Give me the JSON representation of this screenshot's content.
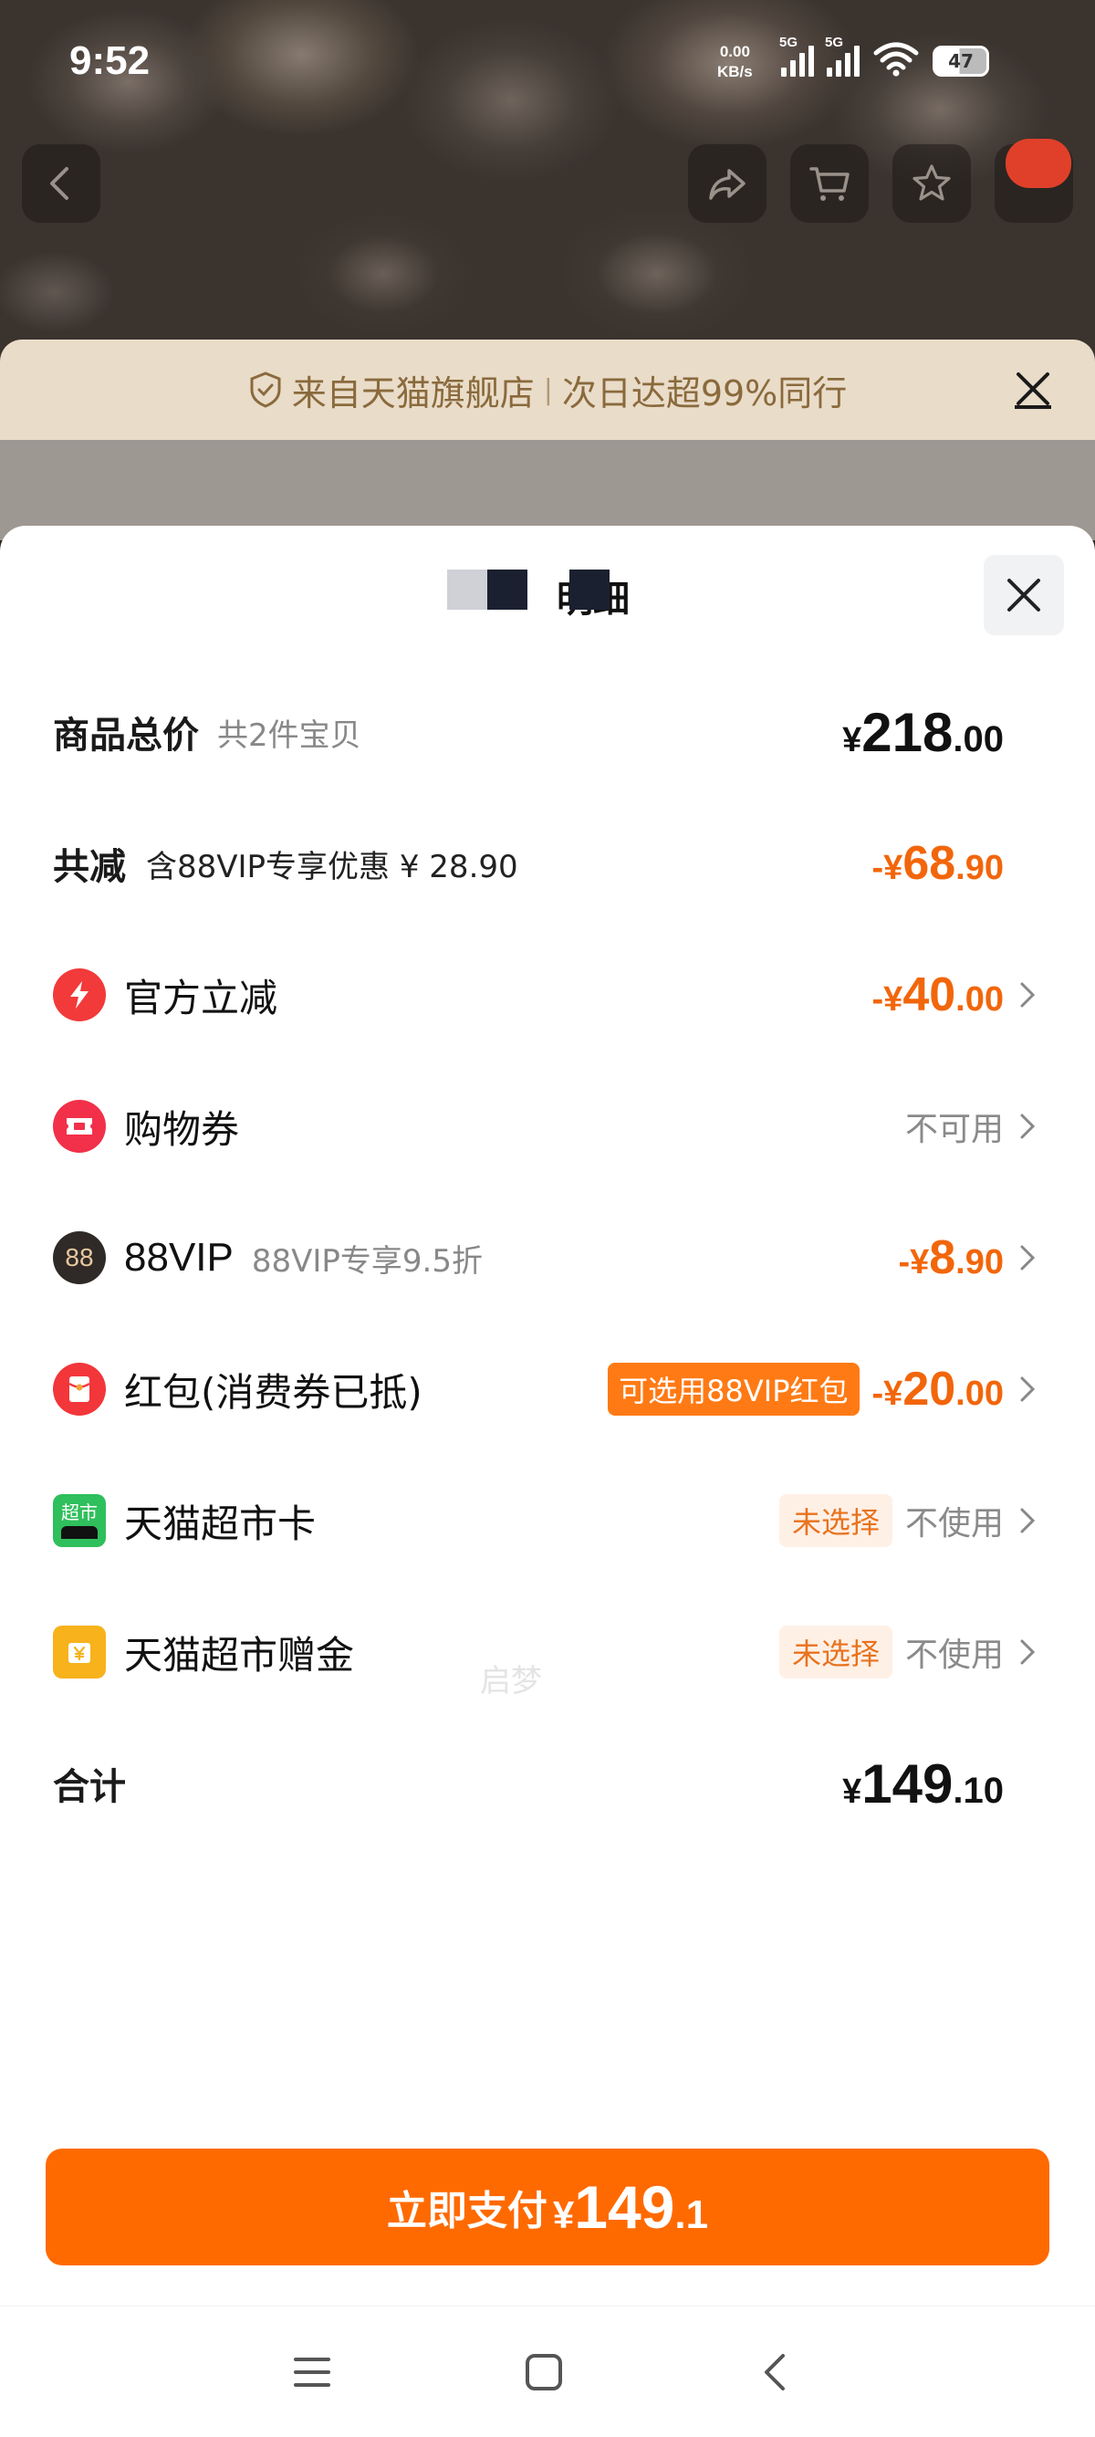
{
  "status_bar": {
    "time": "9:52",
    "net_speed_value": "0.00",
    "net_speed_unit": "KB/s",
    "sim1_label": "5G",
    "sim2_label": "5G",
    "battery": "47"
  },
  "banner": {
    "text_left": "来自天猫旗舰店",
    "separator": "|",
    "text_right": "次日达超99%同行"
  },
  "sheet": {
    "title_fragment": "明细"
  },
  "rows": {
    "total": {
      "label": "商品总价",
      "sublabel": "共2件宝贝",
      "currency": "¥",
      "int": "218",
      "dec": ".00"
    },
    "discount": {
      "label": "共减",
      "sublabel": "含88VIP专享优惠 ¥ 28.90",
      "currency": "-¥",
      "int": "68",
      "dec": ".90"
    },
    "official": {
      "label": "官方立减",
      "currency": "-¥",
      "int": "40",
      "dec": ".00"
    },
    "coupon": {
      "label": "购物券",
      "status": "不可用"
    },
    "vip": {
      "label": "88VIP",
      "sublabel": "88VIP专享9.5折",
      "currency": "-¥",
      "int": "8",
      "dec": ".90",
      "icon_text": "88"
    },
    "redpacket": {
      "label": "红包(消费券已抵)",
      "tag": "可选用88VIP红包",
      "currency": "-¥",
      "int": "20",
      "dec": ".00"
    },
    "market_card": {
      "label": "天猫超市卡",
      "tag": "未选择",
      "status": "不使用",
      "icon_text": "超市"
    },
    "market_gift": {
      "label": "天猫超市赠金",
      "tag": "未选择",
      "status": "不使用"
    },
    "sum": {
      "label": "合计",
      "currency": "¥",
      "int": "149",
      "dec": ".10"
    }
  },
  "watermark": "启梦",
  "pay_button": {
    "label": "立即支付",
    "currency": "¥",
    "int": "149",
    "dec": ".1"
  },
  "colors": {
    "accent": "#ff6a00",
    "discount": "#f2660b",
    "banner_text": "#8a6a3c"
  },
  "icons": [
    "back-icon",
    "share-icon",
    "cart-icon",
    "star-icon",
    "close-icon",
    "lightning-icon",
    "ticket-icon",
    "vip-88-icon",
    "red-packet-icon",
    "market-card-icon",
    "market-gift-icon",
    "chevron-right-icon",
    "menu-icon",
    "home-icon",
    "back-nav-icon"
  ]
}
